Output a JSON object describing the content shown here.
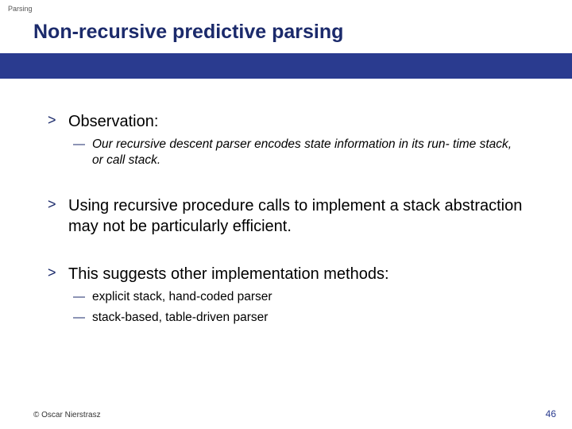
{
  "breadcrumb": "Parsing",
  "title": "Non-recursive predictive parsing",
  "bullets": [
    {
      "text": "Observation:",
      "subs": [
        {
          "text": "Our recursive descent parser encodes state information in its run- time stack, or call stack.",
          "italic": true
        }
      ]
    },
    {
      "text": "Using recursive procedure calls to implement a stack abstraction may not be particularly efficient.",
      "subs": []
    },
    {
      "text": "This suggests other implementation methods:",
      "subs": [
        {
          "text": "explicit stack, hand-coded parser",
          "italic": false
        },
        {
          "text": "stack-based, table-driven parser",
          "italic": false
        }
      ]
    }
  ],
  "footer": {
    "copyright": "© Oscar Nierstrasz",
    "page": "46"
  }
}
